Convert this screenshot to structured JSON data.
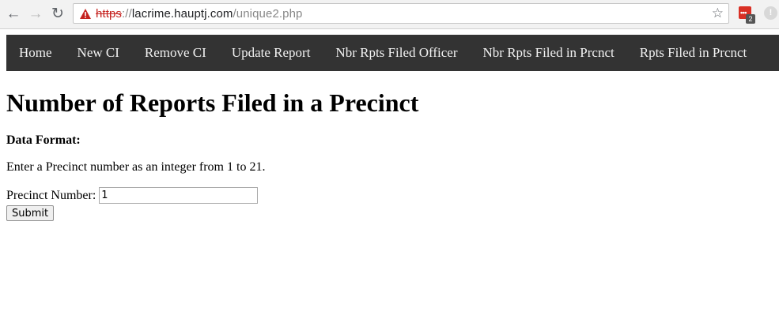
{
  "browser": {
    "url_scheme": "https",
    "url_separator": "://",
    "url_host": "lacrime.hauptj.com",
    "url_path": "/unique2.php",
    "extension_badge": "2",
    "icons": [
      "back-arrow-icon",
      "forward-arrow-icon",
      "reload-icon",
      "security-warning-icon",
      "bookmark-star-icon",
      "extension-icon"
    ]
  },
  "nav": {
    "items": [
      {
        "label": "Home"
      },
      {
        "label": "New CI"
      },
      {
        "label": "Remove CI"
      },
      {
        "label": "Update Report"
      },
      {
        "label": "Nbr Rpts Filed Officer"
      },
      {
        "label": "Nbr Rpts Filed in Prcnct"
      },
      {
        "label": "Rpts Filed in Prcnct"
      }
    ],
    "background_color": "#333333",
    "text_color": "#f2f2f2"
  },
  "main": {
    "title": "Number of Reports Filed in a Precinct",
    "data_format_label": "Data Format:",
    "instructions": "Enter a Precinct number as an integer from 1 to 21.",
    "precinct_label": "Precinct Number:",
    "precinct_value": "1",
    "submit_label": "Submit"
  }
}
